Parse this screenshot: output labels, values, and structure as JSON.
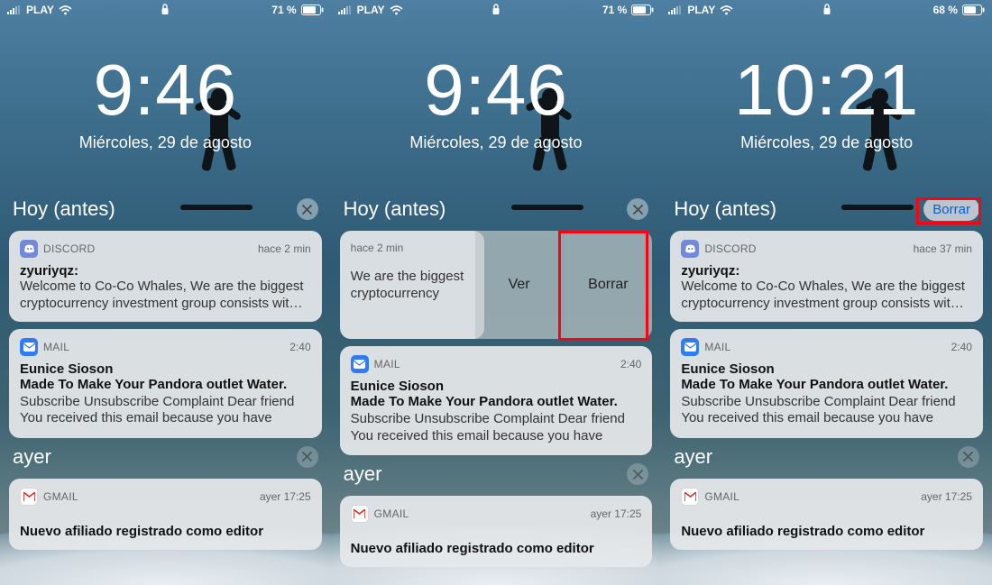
{
  "screens": [
    {
      "carrier": "PLAY",
      "battery": "71 %",
      "time": "9:46",
      "date": "Miércoles, 29 de agosto",
      "section_today": "Hoy (antes)",
      "section_today_action": null,
      "discord": {
        "app": "DISCORD",
        "ts": "hace 2 min",
        "sender": "zyuriyqz:",
        "body": "Welcome to Co-Co Whales, We are the biggest cryptocurrency investment group consists wit…"
      },
      "mail": {
        "app": "MAIL",
        "ts": "2:40",
        "sender": "Eunice Sioson",
        "title": "Made To Make Your Pandora outlet Water.",
        "body": "Subscribe Unsubscribe Complaint Dear friend You received this email because you have sign…"
      },
      "section_yesterday": "ayer",
      "gmail": {
        "app": "GMAIL",
        "ts": "ayer 17:25",
        "title": "Nuevo afiliado registrado como editor"
      }
    },
    {
      "carrier": "PLAY",
      "battery": "71 %",
      "time": "9:46",
      "date": "Miércoles, 29 de agosto",
      "section_today": "Hoy (antes)",
      "section_today_action": null,
      "discord_swipe": {
        "ts": "hace 2 min",
        "body": "We are the biggest cryptocurrency investment group consists wit…",
        "actions": {
          "view": "Ver",
          "delete": "Borrar"
        }
      },
      "mail": {
        "app": "MAIL",
        "ts": "2:40",
        "sender": "Eunice Sioson",
        "title": "Made To Make Your Pandora outlet Water.",
        "body": "Subscribe Unsubscribe Complaint Dear friend You received this email because you have sign…"
      },
      "section_yesterday": "ayer",
      "gmail": {
        "app": "GMAIL",
        "ts": "ayer 17:25",
        "title": "Nuevo afiliado registrado como editor"
      }
    },
    {
      "carrier": "PLAY",
      "battery": "68 %",
      "time": "10:21",
      "date": "Miércoles, 29 de agosto",
      "section_today": "Hoy (antes)",
      "section_today_action": "Borrar",
      "discord": {
        "app": "DISCORD",
        "ts": "hace 37 min",
        "sender": "zyuriyqz:",
        "body": "Welcome to Co-Co Whales, We are the biggest cryptocurrency investment group consists wit…"
      },
      "mail": {
        "app": "MAIL",
        "ts": "2:40",
        "sender": "Eunice Sioson",
        "title": "Made To Make Your Pandora outlet Water.",
        "body": "Subscribe Unsubscribe Complaint Dear friend You received this email because you have sign…"
      },
      "section_yesterday": "ayer",
      "gmail": {
        "app": "GMAIL",
        "ts": "ayer 17:25",
        "title": "Nuevo afiliado registrado como editor"
      }
    }
  ]
}
